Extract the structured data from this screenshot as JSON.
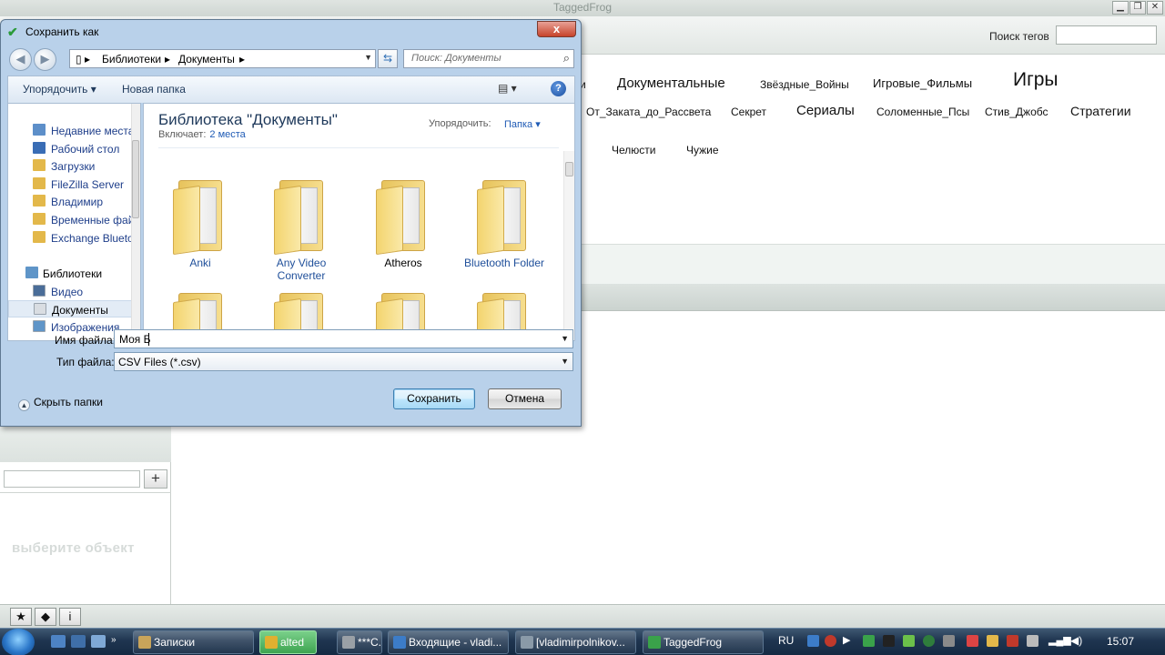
{
  "app": {
    "title": "TaggedFrog",
    "tag_search_label": "Поиск тегов",
    "tags": [
      {
        "label": "и",
        "size": 12
      },
      {
        "label": "Документальные",
        "size": 15
      },
      {
        "label": "Звёздные_Войны",
        "size": 12
      },
      {
        "label": "Игровые_Фильмы",
        "size": 13
      },
      {
        "label": "Игры",
        "size": 21
      },
      {
        "label": "От_Заката_до_Рассвета",
        "size": 12
      },
      {
        "label": "Секрет",
        "size": 12
      },
      {
        "label": "Сериалы",
        "size": 15
      },
      {
        "label": "Соломенные_Псы",
        "size": 12
      },
      {
        "label": "Стив_Джобс",
        "size": 12
      },
      {
        "label": "Стратегии",
        "size": 14
      },
      {
        "label": "Челюсти",
        "size": 12
      },
      {
        "label": "Чужие",
        "size": 12
      }
    ],
    "left_panel": {
      "add_label": "+",
      "empty_hint": "выберите объект"
    },
    "bottom_toolbar": [
      {
        "icon": "star-icon",
        "glyph": "★"
      },
      {
        "icon": "tag-icon",
        "glyph": "◆"
      },
      {
        "icon": "info-icon",
        "glyph": "i"
      }
    ]
  },
  "dialog": {
    "title": "Сохранить как",
    "close_label": "x",
    "breadcrumb": [
      "Библиотеки",
      "Документы"
    ],
    "search_placeholder": "Поиск: Документы",
    "organize_label": "Упорядочить ▾",
    "new_folder_label": "Новая папка",
    "view_label": "▤ ▾",
    "help_label": "?",
    "nav": {
      "favorites": [
        {
          "label": "Недавние места",
          "color": "#5d8fc9"
        },
        {
          "label": "Рабочий стол",
          "color": "#3a6db5"
        },
        {
          "label": "Загрузки",
          "color": "#e3b84a"
        },
        {
          "label": "FileZilla Server",
          "color": "#e3b84a"
        },
        {
          "label": "Владимир",
          "color": "#e3b84a"
        },
        {
          "label": "Временные файлы",
          "color": "#e3b84a"
        },
        {
          "label": "Exchange Bluetooth",
          "color": "#e3b84a"
        }
      ],
      "libraries_header": "Библиотеки",
      "libraries": [
        {
          "label": "Видео",
          "color": "#4a6d98"
        },
        {
          "label": "Документы",
          "color": "#d9dde2",
          "selected": true
        },
        {
          "label": "Изображения",
          "color": "#5f95c8"
        }
      ]
    },
    "library_title": "Библиотека \"Документы\"",
    "includes_label": "Включает:",
    "includes_link": "2 места",
    "sort_label": "Упорядочить:",
    "sort_value": "Папка ▾",
    "folders": [
      {
        "label": "Anki",
        "link": true
      },
      {
        "label": "Any Video Converter",
        "link": true
      },
      {
        "label": "Atheros",
        "link": false
      },
      {
        "label": "Bluetooth Folder",
        "link": true
      },
      {
        "label": "",
        "link": false
      },
      {
        "label": "",
        "link": false
      },
      {
        "label": "",
        "link": false
      },
      {
        "label": "",
        "link": false
      }
    ],
    "file_name_label": "Имя файла:",
    "file_name_value": "Моя Б",
    "file_type_label": "Тип файла:",
    "file_type_value": "CSV Files (*.csv)",
    "hide_folders_label": "Скрыть папки",
    "save_label": "Сохранить",
    "cancel_label": "Отмена"
  },
  "taskbar": {
    "tasks": [
      {
        "label": "Записки",
        "color": "#c8a45a",
        "active": false
      },
      {
        "label": "alted",
        "color": "#e0b030",
        "active": true
      },
      {
        "label": "***C...",
        "color": "#9aa0a6",
        "active": false
      },
      {
        "label": "Входящие - vladi...",
        "color": "#3c7cc8",
        "active": false
      },
      {
        "label": "[vladimirpolnikov...",
        "color": "#8a9aa8",
        "active": false
      },
      {
        "label": "TaggedFrog",
        "color": "#3aa24a",
        "active": false
      }
    ],
    "language": "RU",
    "time": "15:07"
  }
}
